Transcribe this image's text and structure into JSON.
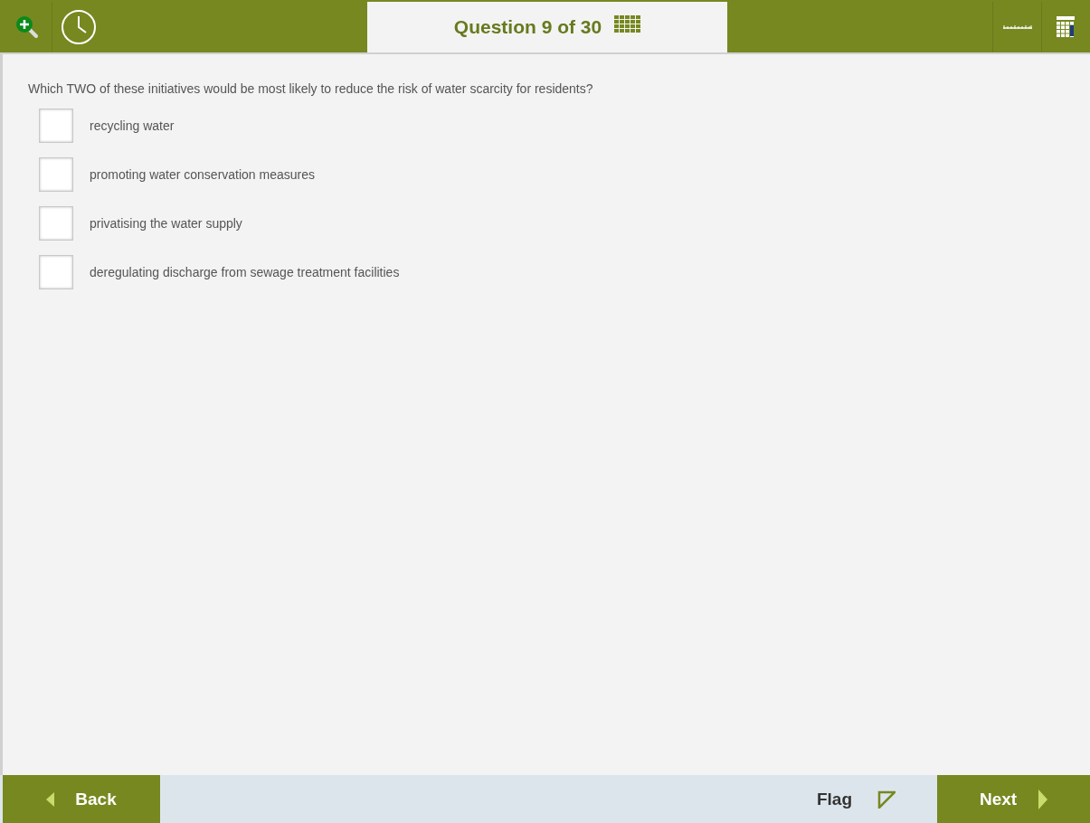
{
  "header": {
    "title": "Question 9 of 30"
  },
  "question": {
    "prompt": "Which TWO of these initiatives would be most likely to reduce the risk of water scarcity for residents?",
    "options": [
      {
        "label": "recycling water",
        "checked": false
      },
      {
        "label": "promoting water conservation measures",
        "checked": false
      },
      {
        "label": "privatising the water supply",
        "checked": false
      },
      {
        "label": "deregulating discharge from sewage treatment facilities",
        "checked": false
      }
    ]
  },
  "footer": {
    "back": "Back",
    "flag": {
      "label": "Flag",
      "flagged": false
    },
    "next": "Next"
  }
}
